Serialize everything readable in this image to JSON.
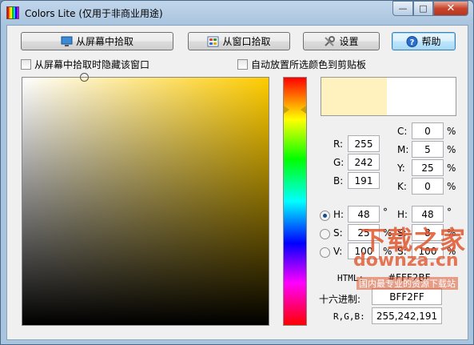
{
  "window": {
    "title": "Colors Lite (仅用于非商业用途)",
    "min": "—",
    "max": "□",
    "close": "✕"
  },
  "buttons": {
    "screen_pick": "从屏幕中拾取",
    "window_pick": "从窗口拾取",
    "settings": "设置",
    "help": "帮助"
  },
  "options": {
    "hide_window": "从屏幕中拾取时隐藏该窗口",
    "auto_copy": "自动放置所选颜色到剪贴板"
  },
  "color": {
    "current_hex": "#FFF2BF",
    "previous_hex": "#FFFFFF"
  },
  "rgb": {
    "r_label": "R:",
    "r": "255",
    "g_label": "G:",
    "g": "242",
    "b_label": "B:",
    "b": "191"
  },
  "cmyk": {
    "c_label": "C:",
    "c": "0",
    "m_label": "M:",
    "m": "5",
    "y_label": "Y:",
    "y": "25",
    "k_label": "K:",
    "k": "0",
    "unit": "%"
  },
  "hsv": {
    "h_label": "H:",
    "h": "48",
    "h_unit": "°",
    "s_label": "S:",
    "s": "25",
    "s_unit": "%",
    "v_label": "V:",
    "v": "100",
    "v_unit": "%"
  },
  "hsl": {
    "h_label": "H:",
    "h": "48",
    "h_unit": "°",
    "s_label": "S:",
    "s": "8",
    "s_unit": "%",
    "l_label": "S:",
    "l": "100",
    "l_unit": "%"
  },
  "output": {
    "html_label": "HTML:",
    "html": "#FFF2BF",
    "hex_label": "十六进制:",
    "hex": "BFF2FF",
    "rgb_label": "R,G,B:",
    "rgb": "255,242,191"
  },
  "watermark": {
    "line1": "下载之家",
    "line2": "downza.cn",
    "line3": "国内最专业的资源下载站"
  }
}
